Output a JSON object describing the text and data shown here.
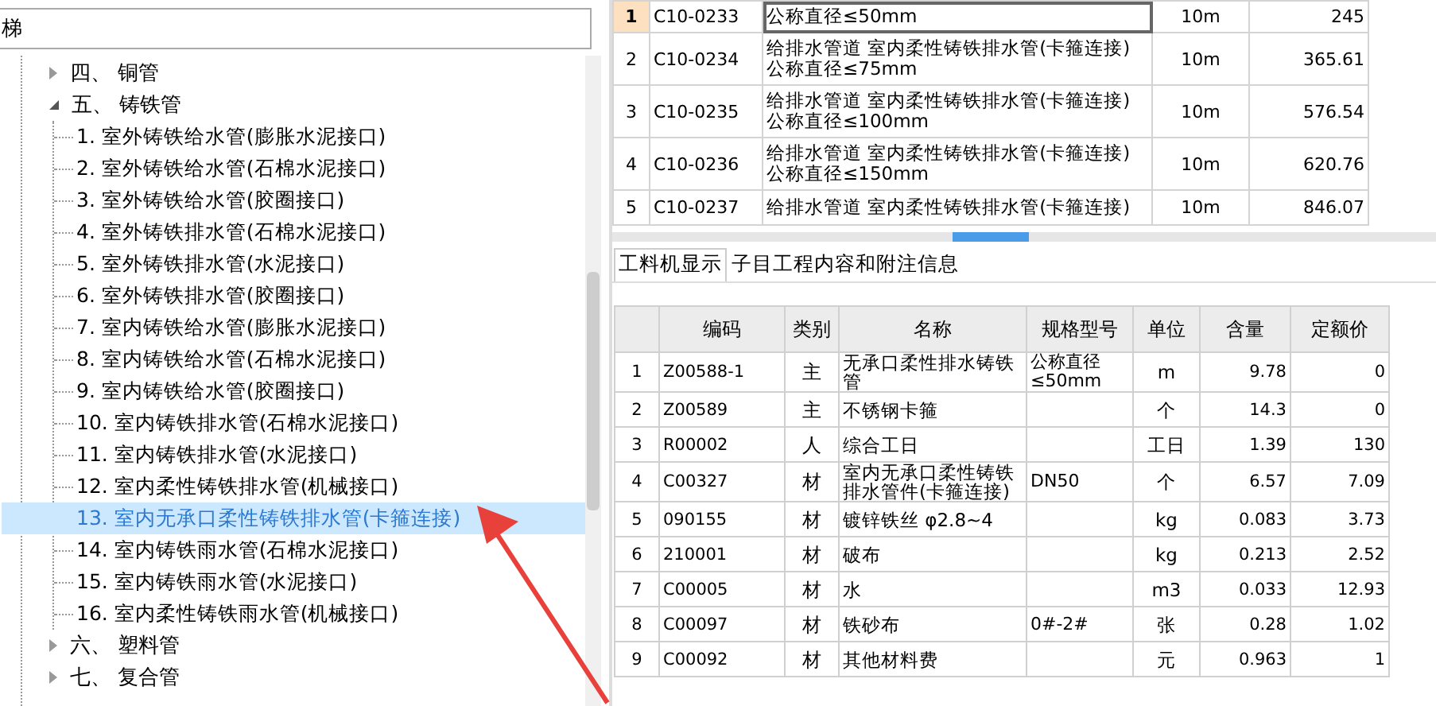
{
  "search": {
    "value": "梯"
  },
  "tree": [
    {
      "label": "四、 铜管",
      "expanded": false
    },
    {
      "label": "五、 铸铁管",
      "expanded": true,
      "children": [
        {
          "label": "1. 室外铸铁给水管(膨胀水泥接口)",
          "selected": false
        },
        {
          "label": "2. 室外铸铁给水管(石棉水泥接口)",
          "selected": false
        },
        {
          "label": "3. 室外铸铁给水管(胶圈接口)",
          "selected": false
        },
        {
          "label": "4. 室外铸铁排水管(石棉水泥接口)",
          "selected": false
        },
        {
          "label": "5. 室外铸铁排水管(水泥接口)",
          "selected": false
        },
        {
          "label": "6. 室外铸铁排水管(胶圈接口)",
          "selected": false
        },
        {
          "label": "7. 室内铸铁给水管(膨胀水泥接口)",
          "selected": false
        },
        {
          "label": "8. 室内铸铁给水管(石棉水泥接口)",
          "selected": false
        },
        {
          "label": "9. 室内铸铁给水管(胶圈接口)",
          "selected": false
        },
        {
          "label": "10. 室内铸铁排水管(石棉水泥接口)",
          "selected": false
        },
        {
          "label": "11. 室内铸铁排水管(水泥接口)",
          "selected": false
        },
        {
          "label": "12. 室内柔性铸铁排水管(机械接口)",
          "selected": false
        },
        {
          "label": "13. 室内无承口柔性铸铁排水管(卡箍连接)",
          "selected": true
        },
        {
          "label": "14. 室内铸铁雨水管(石棉水泥接口)",
          "selected": false
        },
        {
          "label": "15. 室内铸铁雨水管(水泥接口)",
          "selected": false
        },
        {
          "label": "16. 室内柔性铸铁雨水管(机械接口)",
          "selected": false
        }
      ]
    },
    {
      "label": "六、 塑料管",
      "expanded": false
    },
    {
      "label": "七、 复合管",
      "expanded": false
    }
  ],
  "quota_table": {
    "rows": [
      {
        "no": "1",
        "code": "C10-0233",
        "name": "公称直径≤50mm",
        "unit": "10m",
        "price": "245",
        "selected": true
      },
      {
        "no": "2",
        "code": "C10-0234",
        "name": "给排水管道 室内柔性铸铁排水管(卡箍连接) 公称直径≤75mm",
        "unit": "10m",
        "price": "365.61",
        "selected": false
      },
      {
        "no": "3",
        "code": "C10-0235",
        "name": "给排水管道 室内柔性铸铁排水管(卡箍连接) 公称直径≤100mm",
        "unit": "10m",
        "price": "576.54",
        "selected": false
      },
      {
        "no": "4",
        "code": "C10-0236",
        "name": "给排水管道 室内柔性铸铁排水管(卡箍连接) 公称直径≤150mm",
        "unit": "10m",
        "price": "620.76",
        "selected": false
      },
      {
        "no": "5",
        "code": "C10-0237",
        "name": "给排水管道 室内柔性铸铁排水管(卡箍连接)",
        "unit": "10m",
        "price": "846.07",
        "selected": false
      }
    ]
  },
  "tabs": [
    {
      "label": "工料机显示",
      "selected": true
    },
    {
      "label": "子目工程内容和附注信息",
      "selected": false
    }
  ],
  "resource_table": {
    "columns": [
      "编码",
      "类别",
      "名称",
      "规格型号",
      "单位",
      "含量",
      "定额价"
    ],
    "rows": [
      {
        "no": "1",
        "code": "Z00588-1",
        "type": "主",
        "name": "无承口柔性排水铸铁管",
        "spec": "公称直径≤50mm",
        "unit": "m",
        "qty": "9.78",
        "price": "0"
      },
      {
        "no": "2",
        "code": "Z00589",
        "type": "主",
        "name": "不锈钢卡箍",
        "unit": "个",
        "qty": "14.3",
        "price": "0"
      },
      {
        "no": "3",
        "code": "R00002",
        "type": "人",
        "name": "综合工日",
        "unit": "工日",
        "qty": "1.39",
        "price": "130"
      },
      {
        "no": "4",
        "code": "C00327",
        "type": "材",
        "name": "室内无承口柔性铸铁排水管件(卡箍连接)",
        "spec": "DN50",
        "unit": "个",
        "qty": "6.57",
        "price": "7.09"
      },
      {
        "no": "5",
        "code": "090155",
        "type": "材",
        "name": "镀锌铁丝 φ2.8~4",
        "unit": "kg",
        "qty": "0.083",
        "price": "3.73"
      },
      {
        "no": "6",
        "code": "210001",
        "type": "材",
        "name": "破布",
        "unit": "kg",
        "qty": "0.213",
        "price": "2.52"
      },
      {
        "no": "7",
        "code": "C00005",
        "type": "材",
        "name": "水",
        "unit": "m3",
        "qty": "0.033",
        "price": "12.93"
      },
      {
        "no": "8",
        "code": "C00097",
        "type": "材",
        "name": "铁砂布",
        "spec": "0#-2#",
        "unit": "张",
        "qty": "0.28",
        "price": "1.02"
      },
      {
        "no": "9",
        "code": "C00092",
        "type": "材",
        "name": "其他材料费",
        "unit": "元",
        "qty": "0.963",
        "price": "1"
      }
    ]
  }
}
